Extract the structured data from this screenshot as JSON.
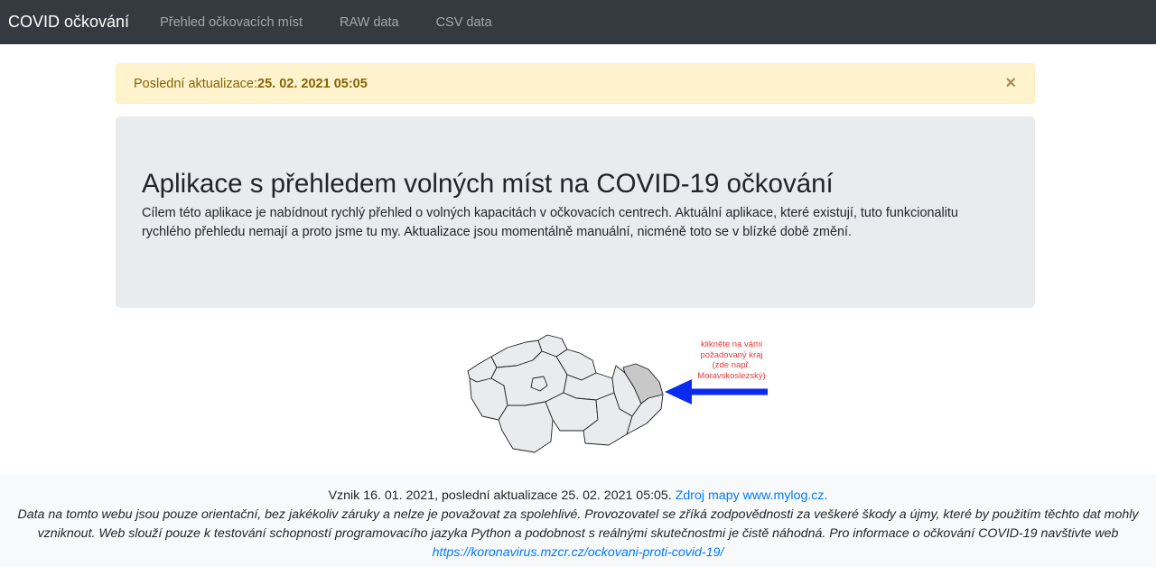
{
  "navbar": {
    "brand": "COVID očkování",
    "links": [
      "Přehled očkovacích míst",
      "RAW data",
      "CSV data"
    ]
  },
  "alert": {
    "label": "Poslední aktualizace:",
    "value": "25. 02. 2021 05:05",
    "close": "×"
  },
  "jumbotron": {
    "title": "Aplikace s přehledem volných míst na COVID-19 očkování",
    "text": "Cílem této aplikace je nabídnout rychlý přehled o volných kapacitách v očkovacích centrech. Aktuální aplikace, které existují, tuto funkcionalitu rychlého přehledu nemají a proto jsme tu my. Aktualizace jsou momentálně manuální, nicméně toto se v blízké době změní."
  },
  "map": {
    "hint_lines": [
      "klikněte na vámi",
      "požadovaný kraj",
      "(zde např.",
      "Moravskoslezský)"
    ],
    "highlight_color": "#c8c8c8",
    "region_color": "#e9ebee",
    "arrow_color": "#0a2cf0"
  },
  "footer": {
    "line1": "Vznik 16. 01. 2021, poslední aktualizace 25. 02. 2021 05:05.",
    "map_link": "Zdroj mapy www.mylog.cz.",
    "disclaimer": "Data na tomto webu jsou pouze orientační, bez jakékoliv záruky a nelze je považovat za spolehlivé. Provozovatel se zříká zodpovědnosti za veškeré škody a újmy, které by použitím těchto dat mohly vzniknout. Web slouží pouze k testování schopností programovacího jazyka Python a podobnost s reálnými skutečnostmi je čistě náhodná. Pro informace o očkování COVID-19 navštivte web",
    "info_link": "https://koronavirus.mzcr.cz/ockovani-proti-covid-19/"
  }
}
